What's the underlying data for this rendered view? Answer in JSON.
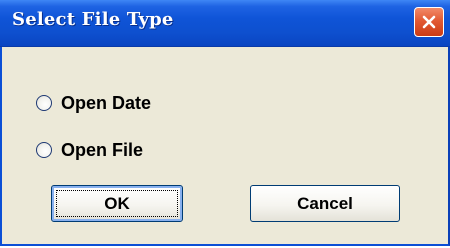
{
  "dialog": {
    "title": "Select File Type",
    "close_icon": "close-icon"
  },
  "options": [
    {
      "label": "Open Date",
      "selected": false
    },
    {
      "label": "Open File",
      "selected": false
    }
  ],
  "buttons": {
    "ok_label": "OK",
    "cancel_label": "Cancel"
  },
  "colors": {
    "titlebar": "#0f54d7",
    "close_button": "#e25a34",
    "dialog_background": "#ece9d8"
  }
}
